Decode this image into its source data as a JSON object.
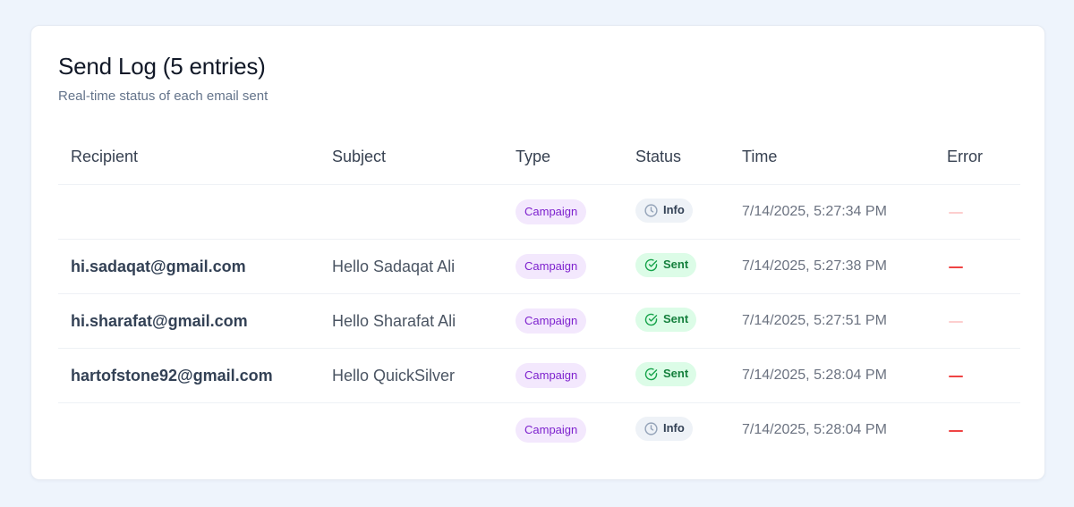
{
  "header": {
    "title": "Send Log (5 entries)",
    "subtitle": "Real-time status of each email sent"
  },
  "table": {
    "columns": [
      "Recipient",
      "Subject",
      "Type",
      "Status",
      "Time",
      "Error"
    ],
    "rows": [
      {
        "recipient": "",
        "subject": "",
        "type": "Campaign",
        "status": "Info",
        "status_kind": "info",
        "time": "7/14/2025, 5:27:34 PM",
        "error": "—",
        "error_style": "muted"
      },
      {
        "recipient": "hi.sadaqat@gmail.com",
        "subject": "Hello Sadaqat Ali",
        "type": "Campaign",
        "status": "Sent",
        "status_kind": "sent",
        "time": "7/14/2025, 5:27:38 PM",
        "error": "—",
        "error_style": "strong"
      },
      {
        "recipient": "hi.sharafat@gmail.com",
        "subject": "Hello Sharafat Ali",
        "type": "Campaign",
        "status": "Sent",
        "status_kind": "sent",
        "time": "7/14/2025, 5:27:51 PM",
        "error": "—",
        "error_style": "muted"
      },
      {
        "recipient": "hartofstone92@gmail.com",
        "subject": "Hello QuickSilver",
        "type": "Campaign",
        "status": "Sent",
        "status_kind": "sent",
        "time": "7/14/2025, 5:28:04 PM",
        "error": "—",
        "error_style": "strong"
      },
      {
        "recipient": "",
        "subject": "",
        "type": "Campaign",
        "status": "Info",
        "status_kind": "info",
        "time": "7/14/2025, 5:28:04 PM",
        "error": "—",
        "error_style": "strong"
      }
    ]
  },
  "icons": {
    "info": "clock-icon",
    "sent": "check-circle-icon"
  },
  "colors": {
    "campaign_badge_bg": "#f3e8fd",
    "campaign_badge_text": "#7e22ce",
    "sent_badge_bg": "#dcfce7",
    "sent_badge_text": "#15803d",
    "info_badge_bg": "#eef2f7",
    "error_dash": "#ef4444"
  }
}
